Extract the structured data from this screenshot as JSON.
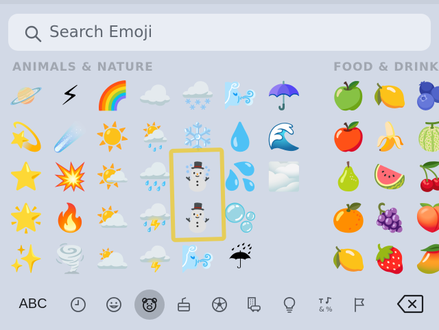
{
  "search": {
    "placeholder": "Search Emoji"
  },
  "sections": {
    "animals": "ANIMALS & NATURE",
    "food": "FOOD & DRINK"
  },
  "grid": {
    "rows": [
      [
        "🪐",
        "⚡",
        "🌈",
        "☁️",
        "🌨️",
        "🌬️",
        "☂️",
        "",
        "🍏",
        "🍋",
        "🫐"
      ],
      [
        "💫",
        "☄️",
        "☀️",
        "🌦️",
        "❄️",
        "💧",
        "🌊",
        "",
        "🍎",
        "🍌",
        "🍈"
      ],
      [
        "⭐",
        "💥",
        "🌤️",
        "🌧️",
        "☃️",
        "💦",
        "🌫️",
        "",
        "🍐",
        "🍉",
        "🍒"
      ],
      [
        "🌟",
        "🔥",
        "⛅",
        "⛈️",
        "⛄",
        "🫧",
        "",
        "",
        "🍊",
        "🍇",
        "🍑"
      ],
      [
        "✨",
        "🌪️",
        "🌥️",
        "🌩️",
        "🌬️",
        "☔",
        "",
        "",
        "🍋",
        "🍓",
        "🥭"
      ]
    ]
  },
  "toolbar": {
    "abc_label": "ABC",
    "categories": [
      {
        "icon": "clock-icon",
        "name": "recent"
      },
      {
        "icon": "smiley-icon",
        "name": "smileys"
      },
      {
        "icon": "bear-icon",
        "name": "animals"
      },
      {
        "icon": "food-icon",
        "name": "food"
      },
      {
        "icon": "soccer-ball-icon",
        "name": "activity"
      },
      {
        "icon": "building-car-icon",
        "name": "travel"
      },
      {
        "icon": "lightbulb-icon",
        "name": "objects"
      },
      {
        "icon": "symbols-icon",
        "name": "symbols"
      },
      {
        "icon": "flag-icon",
        "name": "flags"
      }
    ],
    "active_category": "animals",
    "delete_icon": "delete-backward-icon"
  },
  "colors": {
    "highlight": "#ecc828",
    "active_category_bg": "#a6adb8"
  }
}
